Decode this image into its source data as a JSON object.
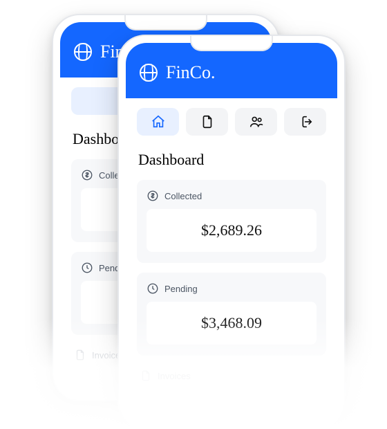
{
  "brand": {
    "name": "FinCo."
  },
  "nav": {
    "items": [
      {
        "icon": "home-icon"
      },
      {
        "icon": "document-icon"
      },
      {
        "icon": "users-icon"
      },
      {
        "icon": "logout-icon"
      }
    ]
  },
  "dashboard": {
    "title": "Dashboard",
    "cards": {
      "collected": {
        "label": "Collected",
        "value": "$2,689.26"
      },
      "pending": {
        "label": "Pending",
        "value": "$3,468.09"
      }
    },
    "lists": {
      "invoices": {
        "label": "Invoices"
      }
    }
  },
  "back_phone": {
    "brand_prefix": "FinC",
    "title_clip": "Dashboard",
    "collected_label_clip": "Collecte",
    "pending_label_clip": "Pending",
    "invoices_label_clip": "Invoices"
  }
}
